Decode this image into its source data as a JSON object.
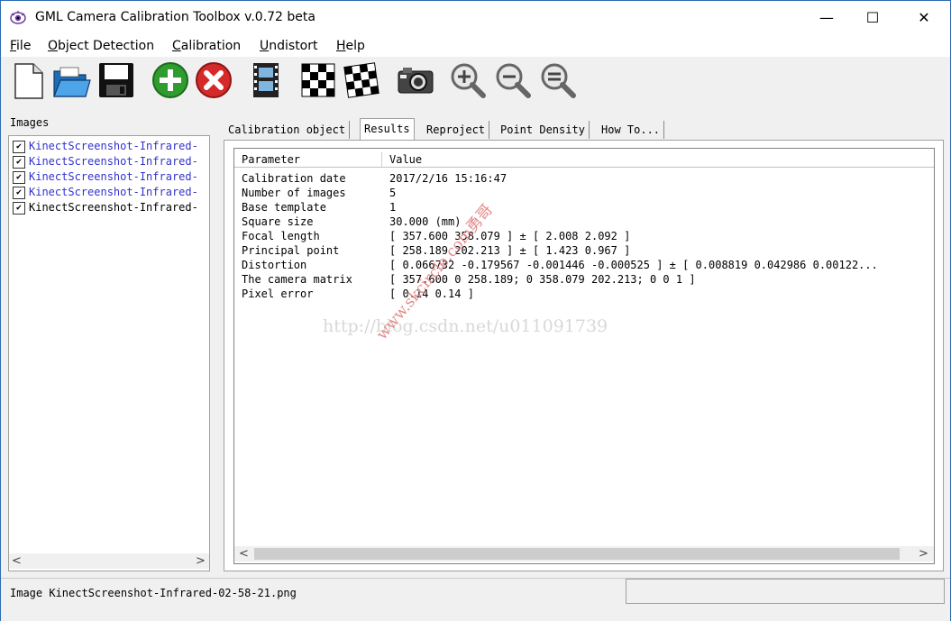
{
  "window": {
    "title": "GML Camera Calibration Toolbox  v.0.72 beta",
    "minimize": "—",
    "maximize": "☐",
    "close": "✕"
  },
  "menu": [
    {
      "label": "File",
      "ul": "F",
      "rest": "ile"
    },
    {
      "label": "Object Detection",
      "ul": "O",
      "rest": "bject Detection"
    },
    {
      "label": "Calibration",
      "ul": "C",
      "rest": "alibration"
    },
    {
      "label": "Undistort",
      "ul": "U",
      "rest": "ndistort"
    },
    {
      "label": "Help",
      "ul": "H",
      "rest": "elp"
    }
  ],
  "toolbar": {
    "icons": [
      "new-file-icon",
      "open-folder-icon",
      "save-icon",
      "add-icon",
      "remove-icon",
      "film-icon",
      "chessboard-icon",
      "chessboard-detect-icon",
      "camera-icon",
      "zoom-in-icon",
      "zoom-out-icon",
      "zoom-fit-icon"
    ]
  },
  "images_panel": {
    "label": "Images",
    "items": [
      {
        "name": "KinectScreenshot-Infrared-",
        "checked": true,
        "color": "#3333cc"
      },
      {
        "name": "KinectScreenshot-Infrared-",
        "checked": true,
        "color": "#3333cc"
      },
      {
        "name": "KinectScreenshot-Infrared-",
        "checked": true,
        "color": "#3333cc"
      },
      {
        "name": "KinectScreenshot-Infrared-",
        "checked": true,
        "color": "#3333cc"
      },
      {
        "name": "KinectScreenshot-Infrared-",
        "checked": true,
        "color": "#000000"
      }
    ],
    "scroll_left": "<",
    "scroll_right": ">"
  },
  "tabs": [
    {
      "label": "Calibration object",
      "active": false
    },
    {
      "label": "Results",
      "active": true
    },
    {
      "label": "Reproject",
      "active": false
    },
    {
      "label": "Point Density",
      "active": false
    },
    {
      "label": "How To...",
      "active": false
    }
  ],
  "results": {
    "col_parameter": "Parameter",
    "col_value": "Value",
    "rows": [
      {
        "param": "Calibration date",
        "value": "2017/2/16 15:16:47"
      },
      {
        "param": "Number of images",
        "value": "5"
      },
      {
        "param": "Base template",
        "value": "1"
      },
      {
        "param": "Square size",
        "value": "30.000 (mm)"
      },
      {
        "param": "Focal length",
        "value": "[ 357.600  358.079 ] ± [ 2.008  2.092 ]"
      },
      {
        "param": "Principal point",
        "value": "[ 258.189  202.213 ] ± [ 1.423  0.967 ]"
      },
      {
        "param": "Distortion",
        "value": "[ 0.066732  -0.179567  -0.001446  -0.000525 ] ± [ 0.008819  0.042986  0.00122..."
      },
      {
        "param": "The camera matrix",
        "value": "[ 357.600  0  258.189;  0  358.079  202.213;  0  0  1 ]"
      },
      {
        "param": "Pixel error",
        "value": "[ 0.14  0.14 ]"
      }
    ],
    "scroll_left": "<",
    "scroll_right": ">"
  },
  "watermark": {
    "url": "http://blog.csdn.net/u011091739",
    "site": "www.skcircle.com勇哥"
  },
  "status": {
    "text": "Image KinectScreenshot-Infrared-02-58-21.png"
  }
}
